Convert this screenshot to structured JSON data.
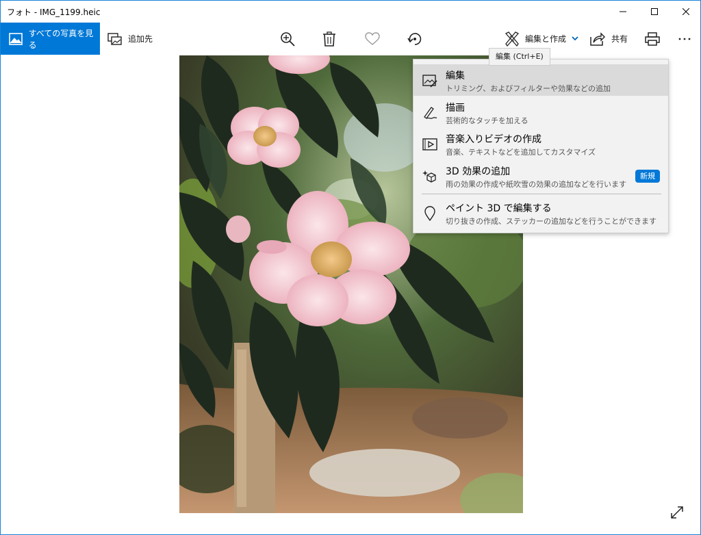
{
  "window": {
    "title": "フォト - IMG_1199.heic"
  },
  "toolbar": {
    "all_photos_label": "すべての写真を見る",
    "add_to_label": "追加先",
    "edit_create_label": "編集と作成",
    "share_label": "共有"
  },
  "tooltip": {
    "text": "編集 (Ctrl+E)"
  },
  "menu": {
    "items": [
      {
        "title": "編集",
        "description": "トリミング、およびフィルターや効果などの追加",
        "icon": "edit-photo-icon"
      },
      {
        "title": "描画",
        "description": "芸術的なタッチを加える",
        "icon": "draw-icon"
      },
      {
        "title": "音楽入りビデオの作成",
        "description": "音楽、テキストなどを追加してカスタマイズ",
        "icon": "video-icon"
      },
      {
        "title": "3D 効果の追加",
        "description": "雨の効果の作成や紙吹雪の効果の追加などを行います",
        "icon": "3d-effects-icon",
        "badge": "新規"
      },
      {
        "title": "ペイント 3D で編集する",
        "description": "切り抜きの作成、ステッカーの追加などを行うことができます",
        "icon": "paint3d-icon"
      }
    ]
  },
  "colors": {
    "accent": "#0078d7",
    "menu_bg": "#f2f2f2",
    "menu_selected": "#dadada"
  }
}
